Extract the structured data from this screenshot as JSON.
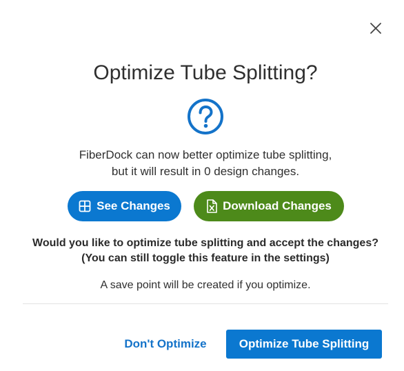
{
  "dialog": {
    "title": "Optimize Tube Splitting?",
    "description_line1": "FiberDock can now better optimize tube splitting,",
    "description_line2": "but it will result in 0 design changes.",
    "see_changes_label": "See Changes",
    "download_changes_label": "Download Changes",
    "question_line1": "Would you like to optimize tube splitting and accept the changes?",
    "question_line2": "(You can still toggle this feature in the settings)",
    "save_point_note": "A save point will be created if you optimize.",
    "dont_optimize_label": "Don't Optimize",
    "optimize_label": "Optimize Tube Splitting"
  },
  "icons": {
    "close": "close-icon",
    "help": "question-circle-icon",
    "see_changes": "table-icon",
    "download_changes": "excel-file-icon"
  },
  "colors": {
    "primary_blue": "#0b78d0",
    "download_green": "#4d8a1a",
    "link_blue": "#1473c9"
  }
}
